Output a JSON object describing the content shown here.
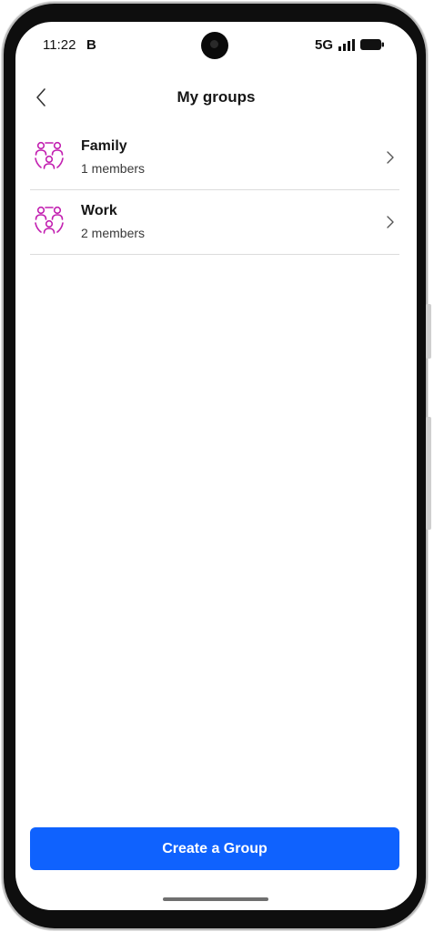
{
  "status_bar": {
    "time": "11:22",
    "carrier_icon_label": "B",
    "network": "5G",
    "icons": [
      "signal-icon",
      "battery-icon",
      "front-camera"
    ]
  },
  "header": {
    "title": "My groups",
    "back_icon": "chevron-left-icon"
  },
  "groups": [
    {
      "name": "Family",
      "members": "1 members",
      "icon": "group-icon"
    },
    {
      "name": "Work",
      "members": "2 members",
      "icon": "group-icon"
    }
  ],
  "cta": {
    "label": "Create a Group"
  },
  "colors": {
    "accent": "#0f62fe",
    "group_icon": "#c21fb0",
    "text_primary": "#161616",
    "text_secondary": "#393939",
    "divider": "#dcdcdc"
  }
}
